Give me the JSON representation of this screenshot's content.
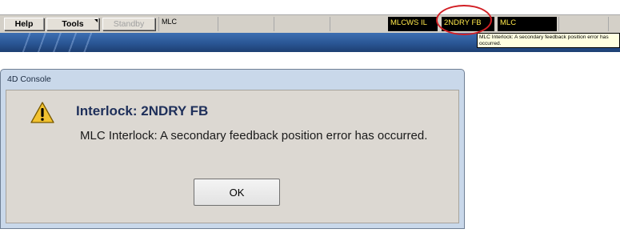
{
  "toolbar": {
    "help_label": "Help",
    "tools_label": "Tools",
    "standby_label": "Standby",
    "field_mlc": "MLC",
    "field_mlcws": "MLCWS IL",
    "field_2ndry": "2NDRY FB",
    "field_mlc2": "MLC"
  },
  "tooltip": {
    "text": "MLC Interlock: A secondary feedback position error has occurred."
  },
  "dialog": {
    "window_title": "4D Console",
    "heading": "Interlock: 2NDRY FB",
    "message": "MLC Interlock: A secondary feedback position error has occurred.",
    "ok_label": "OK",
    "icon": "warning-icon"
  },
  "colors": {
    "status_text": "#ffe84a",
    "status_bg": "#000000",
    "highlight": "#d21f25",
    "banner": "#2a5694"
  }
}
